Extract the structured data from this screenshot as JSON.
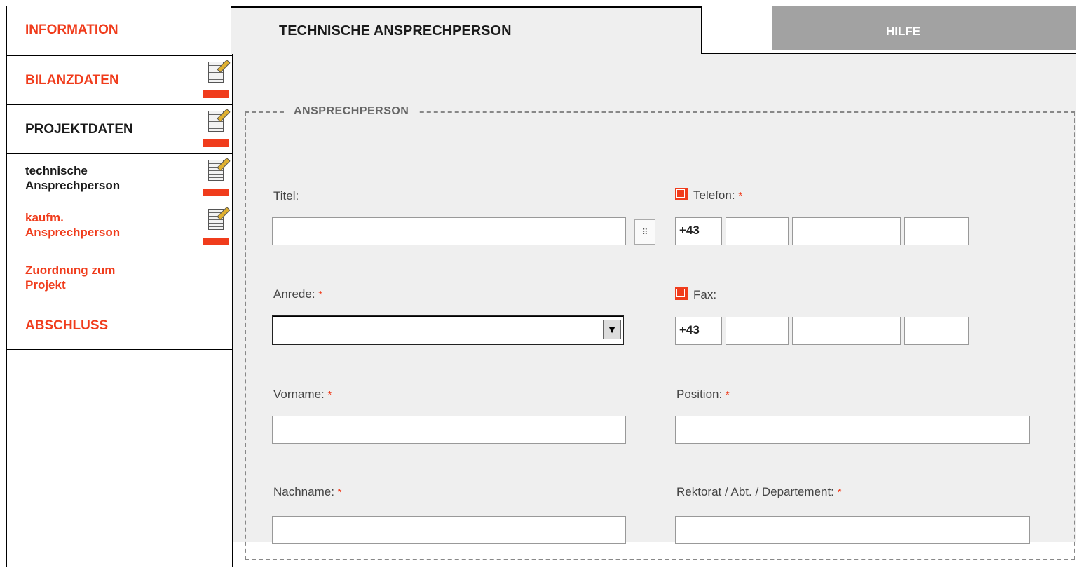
{
  "sidebar": {
    "items": [
      {
        "label": "INFORMATION"
      },
      {
        "label": "BILANZDATEN"
      },
      {
        "label": "PROJEKTDATEN"
      },
      {
        "label_line1": "technische",
        "label_line2": "Ansprechperson"
      },
      {
        "label_line1": "kaufm.",
        "label_line2": "Ansprechperson"
      },
      {
        "label_line1": "Zuordnung zum",
        "label_line2": "Projekt"
      },
      {
        "label": "ABSCHLUSS"
      }
    ]
  },
  "tabs": {
    "active": "TECHNISCHE ANSPRECHPERSON",
    "help": "HILFE"
  },
  "form": {
    "legend": "ANSPRECHPERSON",
    "required_marker": "*",
    "titel": {
      "label": "Titel:",
      "value": ""
    },
    "anrede": {
      "label": "Anrede:",
      "value": ""
    },
    "vorname": {
      "label": "Vorname:",
      "value": ""
    },
    "nachname": {
      "label": "Nachname:",
      "value": ""
    },
    "telefon": {
      "label": "Telefon:",
      "prefix": "+43"
    },
    "fax": {
      "label": "Fax:",
      "prefix": "+43"
    },
    "position": {
      "label": "Position:",
      "value": ""
    },
    "rektorat": {
      "label": "Rektorat / Abt. / Departement:",
      "value": ""
    }
  },
  "colors": {
    "accent": "#f03c1c",
    "tab_inactive": "#a2a2a2",
    "content_bg": "#efefef"
  }
}
